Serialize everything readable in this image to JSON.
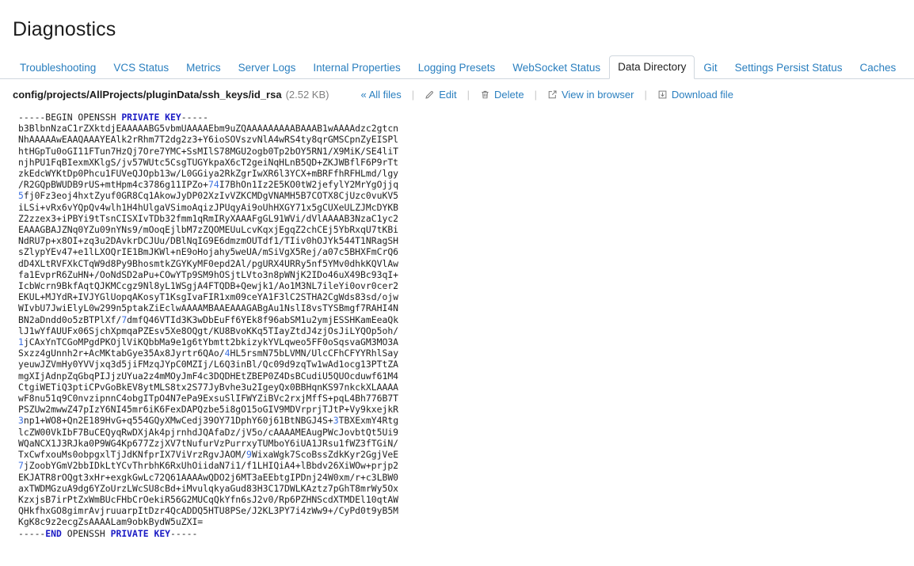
{
  "page": {
    "title": "Diagnostics"
  },
  "tabs": [
    {
      "label": "Troubleshooting",
      "active": false
    },
    {
      "label": "VCS Status",
      "active": false
    },
    {
      "label": "Metrics",
      "active": false
    },
    {
      "label": "Server Logs",
      "active": false
    },
    {
      "label": "Internal Properties",
      "active": false
    },
    {
      "label": "Logging Presets",
      "active": false
    },
    {
      "label": "WebSocket Status",
      "active": false
    },
    {
      "label": "Data Directory",
      "active": true
    },
    {
      "label": "Git",
      "active": false
    },
    {
      "label": "Settings Persist Status",
      "active": false
    },
    {
      "label": "Caches",
      "active": false
    }
  ],
  "filebar": {
    "path": "config/projects/AllProjects/pluginData/ssh_keys/id_rsa",
    "size": "(2.52 KB)",
    "actions": [
      {
        "label": "« All files",
        "icon": "none"
      },
      {
        "label": "Edit",
        "icon": "pencil-icon"
      },
      {
        "label": "Delete",
        "icon": "trash-icon"
      },
      {
        "label": "View in browser",
        "icon": "external-link-icon"
      },
      {
        "label": "Download file",
        "icon": "download-icon"
      }
    ],
    "separator": "|"
  },
  "file_content": {
    "colors": {
      "keyword": "#1a1ac4",
      "number": "#3b6fe0",
      "text": "#222222"
    },
    "lines": [
      [
        {
          "t": "-----BEGIN OPENSSH ",
          "c": "plain"
        },
        {
          "t": "PRIVATE KEY",
          "c": "kw"
        },
        {
          "t": "-----",
          "c": "plain"
        }
      ],
      [
        {
          "t": "b3BlbnNzaC1rZXktdjEAAAAABG5vbmUAAAAEbm9uZQAAAAAAAAABAAAB1wAAAAdzc2gtcn",
          "c": "plain"
        }
      ],
      [
        {
          "t": "NhAAAAAwEAAQAAAYEAlk2rRhm7T2dg2z3+Y6ioSOVszvNlA4wRS4ty8qrGMSCpnZyEISPl",
          "c": "plain"
        }
      ],
      [
        {
          "t": "htHGpTu0oGI11FTun7HzQj7Ore7YMC+SsMIlS78MGU2ogb0Tp2bOY5RN1/X9MiK/SE4liT",
          "c": "plain"
        }
      ],
      [
        {
          "t": "njhPU1FqBIexmXKlgS/jv57WUtc5CsgTUGYkpaX6cT2geiNqHLnB5QD+ZKJWBflF6P9rTt",
          "c": "plain"
        }
      ],
      [
        {
          "t": "zkEdcWYKtDp0Phcu1FUVeQJOpb13w/L0GGiya2RkZgrIwXR6l3YCX+mBRFfhRFHLmd/lgy",
          "c": "plain"
        }
      ],
      [
        {
          "t": "/R2GQpBWUDB9rUS+mtHpm4c3786g11IPZo+",
          "c": "plain"
        },
        {
          "t": "74",
          "c": "num"
        },
        {
          "t": "I7BhOn1Iz2E5KO0tW2jefylY2MrYgOjjq",
          "c": "plain"
        }
      ],
      [
        {
          "t": "5",
          "c": "num"
        },
        {
          "t": "fj0Fz3eoj4hxtZyuf0GR8Cq1AkowJyDP02XzIvVZKCMDgVNAMH5B7COTX8CjUzc0vuKV5",
          "c": "plain"
        }
      ],
      [
        {
          "t": "iLSi+vRx6vYQpQv4wlh1H4hUlgaVSimoAqizJPUqyAi9oUhHXGY71x5gCUXeULZJMcDYKB",
          "c": "plain"
        }
      ],
      [
        {
          "t": "Z2zzex3+iPBYi9tTsnCISXIvTDb32fmm1qRmIRyXAAAFgGL91WVi/dVlAAAAB3NzaC1yc2",
          "c": "plain"
        }
      ],
      [
        {
          "t": "EAAAGBAJZNq0YZu09nYNs9/mOoqEjlbM7zZQOMEUuLcvKqxjEgqZ2chCEj5YbRxqU7tKBi",
          "c": "plain"
        }
      ],
      [
        {
          "t": "NdRU7p+x8OI+zq3u2DAvkrDCJUu/DBlNqIG9E6dmzmOUTdf1/TIiv0hOJYk544T1NRagSH",
          "c": "plain"
        }
      ],
      [
        {
          "t": "sZlypYEv47+e1lLXOQrIE1BmJKWl+nE9oHojahy5weUA/mSiVgX5Rej/a07c5BHXFmCrQ6",
          "c": "plain"
        }
      ],
      [
        {
          "t": "dD4XLtRVFXkCTqW9d8Py9BhosmtkZGYKyMF0epd2Al/pgURX4URRy5nf5YMv0dhkKQVlAw",
          "c": "plain"
        }
      ],
      [
        {
          "t": "fa1EvprR6ZuHN+/OoNdSD2aPu+COwYTp9SM9hOSjtLVto3n8pWNjK2IDo46uX49Bc93qI+",
          "c": "plain"
        }
      ],
      [
        {
          "t": "IcbWcrn9BkfAqtQJKMCcgz9Nl8yL1WSgjA4FTQDB+Qewjk1/Ao1M3NL7ileYi0ovr0cer2",
          "c": "plain"
        }
      ],
      [
        {
          "t": "EKUL+MJYdR+IVJYGlUopqAKosyT1KsgIvaFIR1xm09ceYA1F3lC2STHA2CgWds83sd/ojw",
          "c": "plain"
        }
      ],
      [
        {
          "t": "WIvbU7JwiElyL0w299n5ptakZiEclwAAAAMBAAEAAAGABgAu1NslI8vsTYSBmgf7RAHI4N",
          "c": "plain"
        }
      ],
      [
        {
          "t": "BN2aDndd0o5zBTPlXf/",
          "c": "plain"
        },
        {
          "t": "7",
          "c": "num"
        },
        {
          "t": "dmfQ46VTId3K3wDbEuFf6YEk8f96abSM1u2ymjESSHKamEeaQk",
          "c": "plain"
        }
      ],
      [
        {
          "t": "lJ1wYfAUUFx06SjchXpmqaPZEsv5Xe8OQgt/KU8BvoKKq5TIayZtdJ4zjOsJiLYQOp5oh/",
          "c": "plain"
        }
      ],
      [
        {
          "t": "1",
          "c": "num"
        },
        {
          "t": "jCAxYnTCGoMPgdPKOjlViKQbbMa9e1g6tYbmtt2bkizykYVLqweo5FF0oSqsvaGM3MO3A",
          "c": "plain"
        }
      ],
      [
        {
          "t": "Sxzz4gUnnh2r+AcMKtabGye35Ax8Jyrtr6QAo/",
          "c": "plain"
        },
        {
          "t": "4",
          "c": "num"
        },
        {
          "t": "HL5rsmN75bLVMN/UlcCFhCFYYRhlSay",
          "c": "plain"
        }
      ],
      [
        {
          "t": "yeuwJZVmHy0YVVjxq3d5jiFMzqJYpC0MZIj/L6Q3inBl/Qc09d9zqTw1wAd1ocg13PTtZA",
          "c": "plain"
        }
      ],
      [
        {
          "t": "mgXIjAdnpZqGbqPIJjzUYua2z4mMOyJmF4c3DQDHEtZBEP0Z4DsBCudiU5QUOcduwf61M4",
          "c": "plain"
        }
      ],
      [
        {
          "t": "CtgiWETiQ3ptiCPvGoBkEV8ytMLS8tx2S77JyBvhe3u2IgeyQx0BBHqnKS97nkckXLAAAA",
          "c": "plain"
        }
      ],
      [
        {
          "t": "wF8nu51q9C0nvzipnnC4obgITpO4N7ePa9ExsuSlIFWYZiBVc2rxjMffS+pqL4Bh776B7T",
          "c": "plain"
        }
      ],
      [
        {
          "t": "PSZUw2mwwZ47pIzY6NI45mr6iK6FexDAPQzbe5i8gO15oGIV9MDVrprjTJtP+Vy9kxejkR",
          "c": "plain"
        }
      ],
      [
        {
          "t": "3",
          "c": "num"
        },
        {
          "t": "np1+WO8+Qn2E189HvG+q554GQyXMwCedj39OY71DphY60j61BtNBGJ4S+",
          "c": "plain"
        },
        {
          "t": "3",
          "c": "num"
        },
        {
          "t": "TBXExmY4Rtg",
          "c": "plain"
        }
      ],
      [
        {
          "t": "lcZW00VkIbF7BuCEQyqRwDXjAk4pjrnhdJQAfaDz/jV5o/cAAAAMEAugPWcJovbtQt5Ui9",
          "c": "plain"
        }
      ],
      [
        {
          "t": "WQaNCX1J3RJka0P9WG4Kp677ZzjXV7tNufurVzPurrxyTUMboY6iUA1JRsu1fWZ3fTGiN/",
          "c": "plain"
        }
      ],
      [
        {
          "t": "TxCwfxouMs0obpgxlTjJdKNfprIX7ViVrzRgvJAOM/",
          "c": "plain"
        },
        {
          "t": "9",
          "c": "num"
        },
        {
          "t": "WixaWgk7ScoBssZdkKyr2GgjVeE",
          "c": "plain"
        }
      ],
      [
        {
          "t": "7",
          "c": "num"
        },
        {
          "t": "jZoobYGmV2bbIDkLtYCvThrbhK6RxUhOiidaN7i1/f1LHIQiA4+lBbdv26XiWOw+prjp2",
          "c": "plain"
        }
      ],
      [
        {
          "t": "EKJATR8rOQgt3xHr+exgkGwLc72Q61AAAAwQDO2j6MT3aEEbtgIPDnj24W0xm/r+c3LBW0",
          "c": "plain"
        }
      ],
      [
        {
          "t": "axTWDMGzuA9dg6YZoUrzLWcSU8cBd+iMvulqkyaGud83H3C17DWLKAztz7pGhT8mrWy5Ox",
          "c": "plain"
        }
      ],
      [
        {
          "t": "KzxjsB7irPtZxWmBUcFHbCrOekiR56G2MUCqQkYfn6sJ2v0/Rp6PZHNScdXTMDEl10qtAW",
          "c": "plain"
        }
      ],
      [
        {
          "t": "QHkfhxGO8gimrAvjruuarpItDzr4QcADDQ5HTU8PSe/J2KL3PY7i4zWw9+/CyPd0t9yB5M",
          "c": "plain"
        }
      ],
      [
        {
          "t": "KgK8c9z2ecgZsAAAALam9obkBydW5uZXI=",
          "c": "plain"
        }
      ],
      [
        {
          "t": "-----",
          "c": "plain"
        },
        {
          "t": "END",
          "c": "kw"
        },
        {
          "t": " OPENSSH ",
          "c": "plain"
        },
        {
          "t": "PRIVATE KEY",
          "c": "kw"
        },
        {
          "t": "-----",
          "c": "plain"
        }
      ]
    ]
  }
}
